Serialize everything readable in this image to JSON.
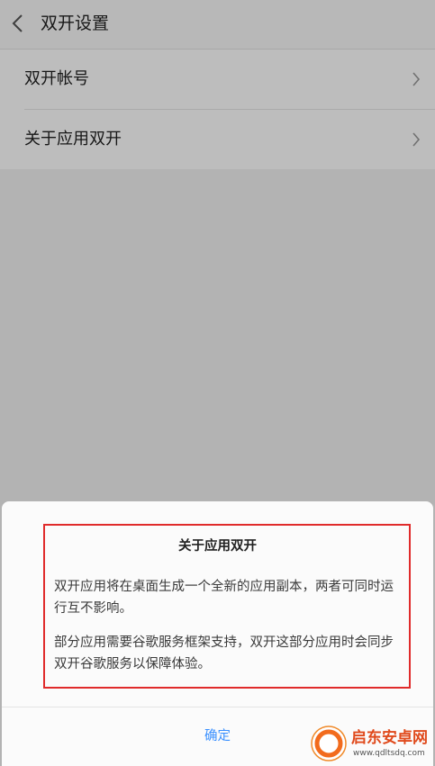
{
  "header": {
    "title": "双开设置",
    "back_icon": "chevron-left-icon"
  },
  "list": {
    "items": [
      {
        "label": "双开帐号",
        "icon": "chevron-right-icon"
      },
      {
        "label": "关于应用双开",
        "icon": "chevron-right-icon"
      }
    ]
  },
  "dialog": {
    "title": "关于应用双开",
    "paragraphs": [
      "双开应用将在桌面生成一个全新的应用副本，两者可同时运行互不影响。",
      "部分应用需要谷歌服务框架支持，双开这部分应用时会同步双开谷歌服务以保障体验。"
    ],
    "confirm_label": "确定"
  },
  "annotation": {
    "highlight_color": "#e02b2b"
  },
  "watermark": {
    "name": "启东安卓网",
    "url": "www.qdltsdq.com"
  },
  "colors": {
    "accent": "#3a90ff",
    "background": "#f2f2f2"
  }
}
